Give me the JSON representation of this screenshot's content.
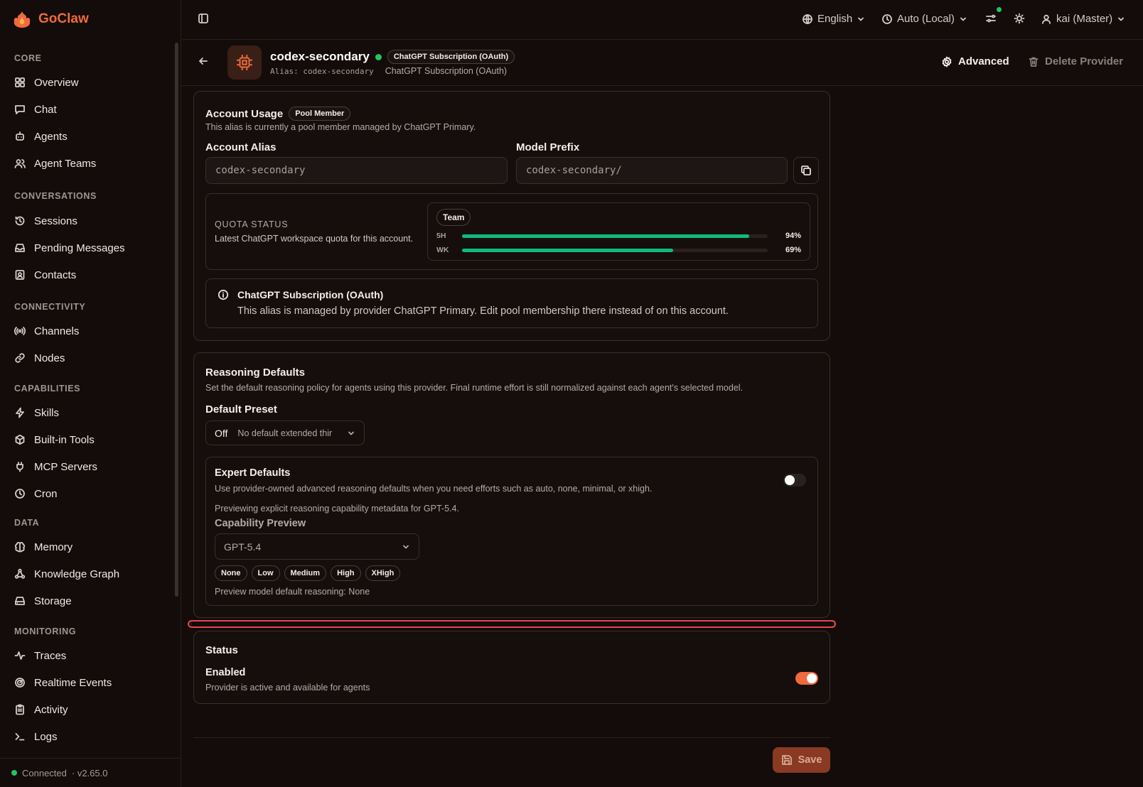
{
  "app": {
    "name": "GoClaw",
    "brand_color": "#ef6a3c",
    "status": "Connected",
    "version": "· v2.65.0"
  },
  "sidebar": {
    "sections": [
      {
        "title": "CORE",
        "items": [
          {
            "label": "Overview",
            "icon": "grid-icon"
          },
          {
            "label": "Chat",
            "icon": "chat-icon"
          },
          {
            "label": "Agents",
            "icon": "bot-icon"
          },
          {
            "label": "Agent Teams",
            "icon": "users-icon"
          }
        ]
      },
      {
        "title": "CONVERSATIONS",
        "items": [
          {
            "label": "Sessions",
            "icon": "history-icon"
          },
          {
            "label": "Pending Messages",
            "icon": "inbox-icon"
          },
          {
            "label": "Contacts",
            "icon": "contact-icon"
          }
        ]
      },
      {
        "title": "CONNECTIVITY",
        "items": [
          {
            "label": "Channels",
            "icon": "radio-icon"
          },
          {
            "label": "Nodes",
            "icon": "link-icon"
          }
        ]
      },
      {
        "title": "CAPABILITIES",
        "items": [
          {
            "label": "Skills",
            "icon": "zap-icon"
          },
          {
            "label": "Built-in Tools",
            "icon": "package-icon"
          },
          {
            "label": "MCP Servers",
            "icon": "plug-icon"
          },
          {
            "label": "Cron",
            "icon": "clock-icon"
          }
        ]
      },
      {
        "title": "DATA",
        "items": [
          {
            "label": "Memory",
            "icon": "brain-icon"
          },
          {
            "label": "Knowledge Graph",
            "icon": "graph-icon"
          },
          {
            "label": "Storage",
            "icon": "drive-icon"
          }
        ]
      },
      {
        "title": "MONITORING",
        "items": [
          {
            "label": "Traces",
            "icon": "activity-icon"
          },
          {
            "label": "Realtime Events",
            "icon": "radar-icon"
          },
          {
            "label": "Activity",
            "icon": "clipboard-icon"
          },
          {
            "label": "Logs",
            "icon": "terminal-icon"
          }
        ]
      }
    ]
  },
  "topbar": {
    "language": "English",
    "timezone": "Auto (Local)",
    "user": "kai (Master)"
  },
  "header": {
    "name": "codex-secondary",
    "type_badge": "ChatGPT Subscription (OAuth)",
    "alias_text": "Alias: codex-secondary",
    "type_text": "ChatGPT Subscription (OAuth)",
    "advanced": "Advanced",
    "delete": "Delete Provider"
  },
  "account_usage": {
    "title": "Account Usage",
    "badge": "Pool Member",
    "desc": "This alias is currently a pool member managed by ChatGPT Primary.",
    "alias_label": "Account Alias",
    "alias_value": "codex-secondary",
    "prefix_label": "Model Prefix",
    "prefix_value": "codex-secondary/",
    "quota": {
      "title": "QUOTA STATUS",
      "desc": "Latest ChatGPT workspace quota for this account.",
      "plan": "Team",
      "rows": [
        {
          "label": "5H",
          "value": 0.94,
          "text": "94%"
        },
        {
          "label": "WK",
          "value": 0.69,
          "text": "69%"
        }
      ]
    },
    "info_title": "ChatGPT Subscription (OAuth)",
    "info_text": "This alias is managed by provider ChatGPT Primary. Edit pool membership there instead of on this account."
  },
  "reasoning": {
    "title": "Reasoning Defaults",
    "desc": "Set the default reasoning policy for agents using this provider. Final runtime effort is still normalized against each agent's selected model.",
    "preset_label": "Default Preset",
    "preset_value": "Off",
    "preset_desc": "No default extended thir",
    "expert": {
      "title": "Expert Defaults",
      "desc": "Use provider-owned advanced reasoning defaults when you need efforts such as auto, none, minimal, or xhigh.",
      "enabled": false,
      "preview_note": "Previewing explicit reasoning capability metadata for GPT-5.4.",
      "cap_label": "Capability Preview",
      "cap_value": "GPT-5.4",
      "levels": [
        "None",
        "Low",
        "Medium",
        "High",
        "XHigh"
      ],
      "default_text": "Preview model default reasoning: None"
    }
  },
  "status": {
    "title": "Status",
    "enabled_label": "Enabled",
    "enabled_desc": "Provider is active and available for agents",
    "enabled": true
  },
  "footer": {
    "save": "Save"
  },
  "colors": {
    "bg": "#130c0a",
    "accent": "#ef6a3c",
    "success": "#10b981",
    "highlight": "#e5484d"
  }
}
